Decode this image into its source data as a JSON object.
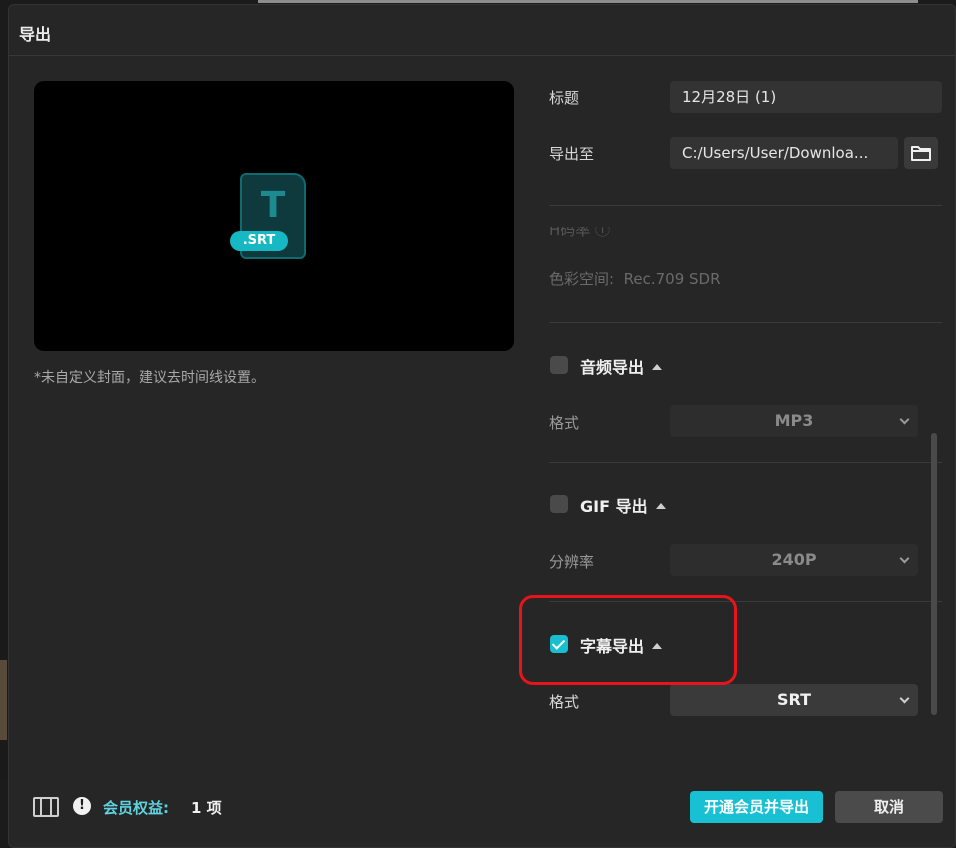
{
  "dialog": {
    "title": "导出"
  },
  "preview": {
    "file_badge": ".SRT",
    "doc_letter": "T",
    "cover_hint": "*未自定义封面，建议去时间线设置。"
  },
  "settings": {
    "title_label": "标题",
    "title_value": "12月28日 (1)",
    "export_to_label": "导出至",
    "export_to_value": "C:/Users/User/Downloa...",
    "color_space_label": "色彩空间:",
    "color_space_value": "Rec.709 SDR",
    "partial_row_label": "H码率 ⓘ"
  },
  "audio_export": {
    "title": "音频导出",
    "checked": false,
    "format_label": "格式",
    "format_value": "MP3"
  },
  "gif_export": {
    "title": "GIF 导出",
    "checked": false,
    "resolution_label": "分辨率",
    "resolution_value": "240P"
  },
  "subtitle_export": {
    "title": "字幕导出",
    "checked": true,
    "format_label": "格式",
    "format_value": "SRT"
  },
  "footer": {
    "member_label": "会员权益:",
    "member_count": "1 项",
    "primary_button": "开通会员并导出",
    "cancel_button": "取消"
  },
  "colors": {
    "accent": "#17c0d2",
    "highlight": "#e8141c"
  }
}
